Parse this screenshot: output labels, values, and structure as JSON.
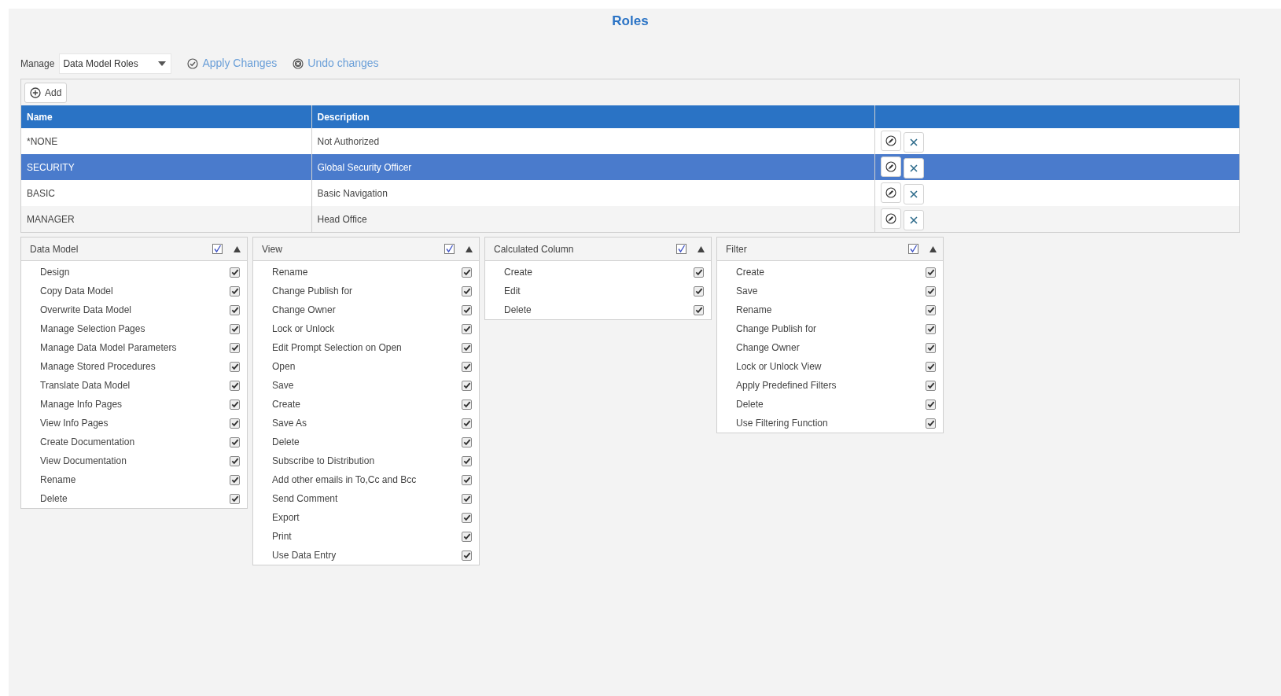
{
  "title": "Roles",
  "manage": {
    "label": "Manage",
    "value": "Data Model Roles"
  },
  "actions": [
    {
      "kind": "apply",
      "label": "Apply Changes"
    },
    {
      "kind": "undo",
      "label": "Undo changes"
    }
  ],
  "add_button": "Add",
  "table": {
    "columns": [
      "Name",
      "Description"
    ],
    "rows": [
      {
        "name": "*NONE",
        "description": "Not Authorized",
        "selected": false
      },
      {
        "name": "SECURITY",
        "description": "Global Security Officer",
        "selected": true
      },
      {
        "name": "BASIC",
        "description": "Basic Navigation",
        "selected": false
      },
      {
        "name": "MANAGER",
        "description": "Head Office",
        "selected": false
      }
    ]
  },
  "panels": [
    {
      "title": "Data Model",
      "all_checked": true,
      "items": [
        {
          "label": "Design",
          "checked": true
        },
        {
          "label": "Copy Data Model",
          "checked": true
        },
        {
          "label": "Overwrite Data Model",
          "checked": true
        },
        {
          "label": "Manage Selection Pages",
          "checked": true
        },
        {
          "label": "Manage Data Model Parameters",
          "checked": true
        },
        {
          "label": "Manage Stored Procedures",
          "checked": true
        },
        {
          "label": "Translate Data Model",
          "checked": true
        },
        {
          "label": "Manage Info Pages",
          "checked": true
        },
        {
          "label": "View Info Pages",
          "checked": true
        },
        {
          "label": "Create Documentation",
          "checked": true
        },
        {
          "label": "View Documentation",
          "checked": true
        },
        {
          "label": "Rename",
          "checked": true
        },
        {
          "label": "Delete",
          "checked": true
        }
      ]
    },
    {
      "title": "View",
      "all_checked": true,
      "items": [
        {
          "label": "Rename",
          "checked": true
        },
        {
          "label": "Change Publish for",
          "checked": true
        },
        {
          "label": "Change Owner",
          "checked": true
        },
        {
          "label": "Lock or Unlock",
          "checked": true
        },
        {
          "label": "Edit Prompt Selection on Open",
          "checked": true
        },
        {
          "label": "Open",
          "checked": true
        },
        {
          "label": "Save",
          "checked": true
        },
        {
          "label": "Create",
          "checked": true
        },
        {
          "label": "Save As",
          "checked": true
        },
        {
          "label": "Delete",
          "checked": true
        },
        {
          "label": "Subscribe to Distribution",
          "checked": true
        },
        {
          "label": "Add other emails in To,Cc and Bcc",
          "checked": true
        },
        {
          "label": "Send Comment",
          "checked": true
        },
        {
          "label": "Export",
          "checked": true
        },
        {
          "label": "Print",
          "checked": true
        },
        {
          "label": "Use Data Entry",
          "checked": true
        }
      ]
    },
    {
      "title": "Calculated Column",
      "all_checked": true,
      "items": [
        {
          "label": "Create",
          "checked": true
        },
        {
          "label": "Edit",
          "checked": true
        },
        {
          "label": "Delete",
          "checked": true
        }
      ]
    },
    {
      "title": "Filter",
      "all_checked": true,
      "items": [
        {
          "label": "Create",
          "checked": true
        },
        {
          "label": "Save",
          "checked": true
        },
        {
          "label": "Rename",
          "checked": true
        },
        {
          "label": "Change Publish for",
          "checked": true
        },
        {
          "label": "Change Owner",
          "checked": true
        },
        {
          "label": "Lock or Unlock View",
          "checked": true
        },
        {
          "label": "Apply Predefined Filters",
          "checked": true
        },
        {
          "label": "Delete",
          "checked": true
        },
        {
          "label": "Use Filtering Function",
          "checked": true
        }
      ]
    }
  ]
}
